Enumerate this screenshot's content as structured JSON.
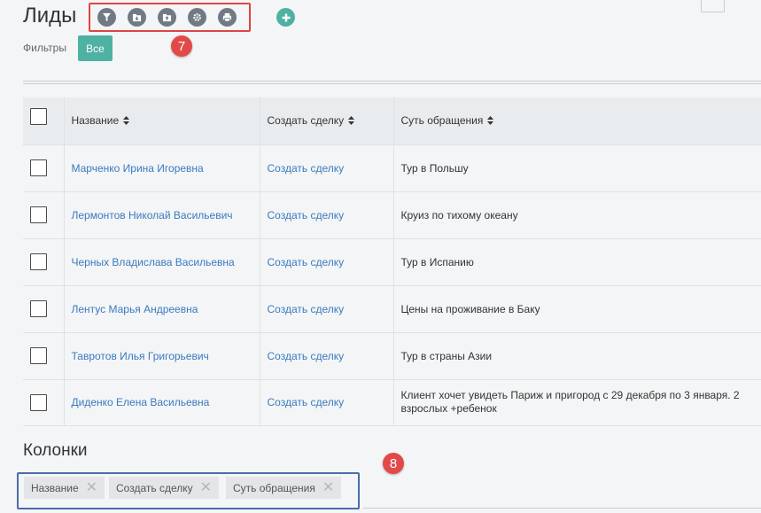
{
  "page": {
    "title": "Лиды"
  },
  "toolbar": {
    "buttons": [
      {
        "icon": "filter-icon"
      },
      {
        "icon": "folder-download-icon"
      },
      {
        "icon": "folder-upload-icon"
      },
      {
        "icon": "gear-icon"
      },
      {
        "icon": "print-icon"
      }
    ],
    "add_icon": "plus-icon",
    "button_color": "#707a84",
    "add_color": "#4fb1a2"
  },
  "annotations": {
    "toolbar_number": "7",
    "columns_number": "8",
    "color": "#e24a4a"
  },
  "filters": {
    "label": "Фильтры",
    "active": "Все"
  },
  "table": {
    "headers": [
      "Название",
      "Создать сделку",
      "Суть обращения"
    ],
    "rows": [
      {
        "name": "Марченко Ирина Игоревна",
        "action": "Создать сделку",
        "subject": "Тур в Польшу"
      },
      {
        "name": "Лермонтов Николай Васильевич",
        "action": "Создать сделку",
        "subject": "Круиз по тихому океану"
      },
      {
        "name": "Черных Владислава Васильевна",
        "action": "Создать сделку",
        "subject": "Тур в Испанию"
      },
      {
        "name": "Лентус Марья Андреевна",
        "action": "Создать сделку",
        "subject": "Цены на проживание в Баку"
      },
      {
        "name": "Тавротов Илья Григорьевич",
        "action": "Создать сделку",
        "subject": "Тур в страны Азии"
      },
      {
        "name": "Диденко Елена Васильевна",
        "action": "Создать сделку",
        "subject": "Клиент хочет увидеть Париж и пригород с 29 декабря по 3 января. 2 взрослых +ребенок"
      }
    ]
  },
  "columns": {
    "title": "Колонки",
    "chips": [
      "Название",
      "Создать сделку",
      "Суть обращения"
    ]
  },
  "colors": {
    "accent": "#4fb1a2",
    "link": "#3a7ac0"
  }
}
